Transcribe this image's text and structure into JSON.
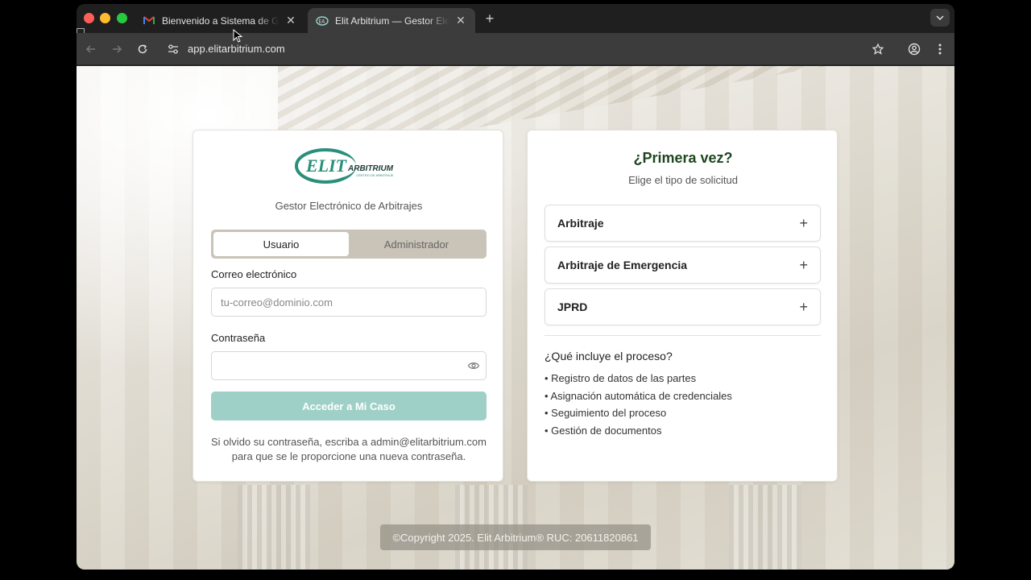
{
  "browser": {
    "tabs": [
      {
        "title": "Bienvenido a Sistema de Gestor Electrónico de Arbitrajes",
        "icon": "gmail-icon",
        "active": false
      },
      {
        "title": "Elit Arbitrium — Gestor Electrónico de Arbitrajes",
        "icon": "elit-favicon-icon",
        "active": true
      }
    ],
    "url": "app.elitarbitrium.com"
  },
  "login": {
    "logo": {
      "brand": "ELIT",
      "name": "ARBITRIUM",
      "tagline": "CENTRO DE ARBITRAJE"
    },
    "subtitle": "Gestor Electrónico de Arbitrajes",
    "segments": {
      "user": "Usuario",
      "admin": "Administrador",
      "selected": "Usuario"
    },
    "email_label": "Correo electrónico",
    "email_placeholder": "tu-correo@dominio.com",
    "email_value": "",
    "password_label": "Contraseña",
    "password_value": "",
    "submit_label": "Acceder a Mi Caso",
    "help_line1": "Si olvido su contraseña, escriba a admin@elitarbitrium.com",
    "help_line2": "para que se le proporcione una nueva contraseña."
  },
  "first_time": {
    "title": "¿Primera vez?",
    "subtitle": "Elige el tipo de solicitud",
    "options": [
      {
        "label": "Arbitraje",
        "icon": "plus-icon"
      },
      {
        "label": "Arbitraje de Emergencia",
        "icon": "plus-icon"
      },
      {
        "label": "JPRD",
        "icon": "plus-icon"
      }
    ],
    "includes_title": "¿Qué incluye el proceso?",
    "includes": [
      "• Registro de datos de las partes",
      "• Asignación automática de credenciales",
      "• Seguimiento del proceso",
      "• Gestión de documentos"
    ]
  },
  "footer": "©Copyright 2025. Elit Arbitrium® RUC: 20611820861",
  "colors": {
    "title_green": "#1e4620",
    "submit_disabled": "#9ed0c7",
    "segment_bg": "#c9c3b8",
    "logo_teal": "#2a8f7a"
  }
}
